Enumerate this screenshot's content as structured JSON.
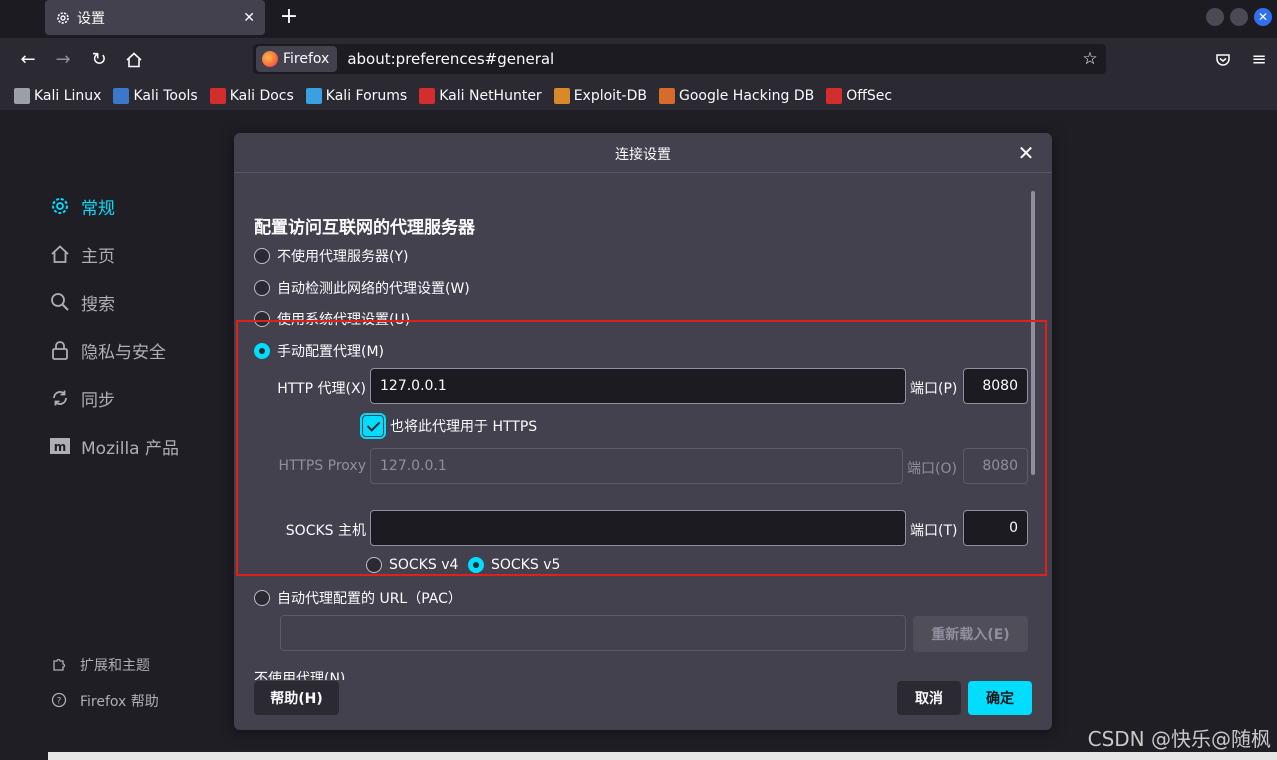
{
  "tab": {
    "title": "设置",
    "close": "✕"
  },
  "newtab": "+",
  "nav": {
    "identity_label": "Firefox",
    "url": "about:preferences#general"
  },
  "bookmarks": [
    {
      "label": "Kali Linux",
      "icon": "kali-dragon-icon",
      "color": "#9aa0a6"
    },
    {
      "label": "Kali Tools",
      "icon": "kali-tools-icon",
      "color": "#3a78c9"
    },
    {
      "label": "Kali Docs",
      "icon": "kali-docs-icon",
      "color": "#d32d2d"
    },
    {
      "label": "Kali Forums",
      "icon": "kali-forums-icon",
      "color": "#3aa0e0"
    },
    {
      "label": "Kali NetHunter",
      "icon": "nethunter-icon",
      "color": "#d32d2d"
    },
    {
      "label": "Exploit-DB",
      "icon": "exploit-db-icon",
      "color": "#d88a2a"
    },
    {
      "label": "Google Hacking DB",
      "icon": "ghdb-icon",
      "color": "#d86a2a"
    },
    {
      "label": "OffSec",
      "icon": "offsec-icon",
      "color": "#d32d2d"
    }
  ],
  "sidebar": {
    "items": [
      {
        "label": "常规",
        "icon": "gear-icon",
        "active": true
      },
      {
        "label": "主页",
        "icon": "home-icon"
      },
      {
        "label": "搜索",
        "icon": "search-icon"
      },
      {
        "label": "隐私与安全",
        "icon": "lock-icon"
      },
      {
        "label": "同步",
        "icon": "sync-icon"
      },
      {
        "label": "Mozilla 产品",
        "icon": "mozilla-icon"
      }
    ],
    "footer": [
      {
        "label": "扩展和主题",
        "icon": "puzzle-icon"
      },
      {
        "label": "Firefox 帮助",
        "icon": "help-icon"
      }
    ]
  },
  "dialog": {
    "title": "连接设置",
    "section_title": "配置访问互联网的代理服务器",
    "options": {
      "no_proxy": "不使用代理服务器(Y)",
      "auto_detect": "自动检测此网络的代理设置(W)",
      "system": "使用系统代理设置(U)",
      "manual": "手动配置代理(M)",
      "auto_url": "自动代理配置的 URL（PAC）"
    },
    "selected_option": "manual",
    "http_label": "HTTP 代理(X)",
    "http_value": "127.0.0.1",
    "http_port_label": "端口(P)",
    "http_port": "8080",
    "https_checkbox_label": "也将此代理用于 HTTPS",
    "https_checked": true,
    "https_label": "HTTPS Proxy",
    "https_value": "127.0.0.1",
    "https_port_label": "端口(O)",
    "https_port": "8080",
    "socks_label": "SOCKS 主机",
    "socks_value": "",
    "socks_port_label": "端口(T)",
    "socks_port": "0",
    "socks_v4": "SOCKS v4",
    "socks_v5": "SOCKS v5",
    "socks_version": "v5",
    "pac_value": "",
    "reload_button": "重新载入(E)",
    "no_proxy_for": "不使用代理(N)",
    "help_button": "帮助(H)",
    "cancel_button": "取消",
    "ok_button": "确定"
  },
  "colors": {
    "accent": "#00ddff",
    "highlight_box": "#e0201b"
  },
  "watermark": "CSDN @快乐@随枫"
}
